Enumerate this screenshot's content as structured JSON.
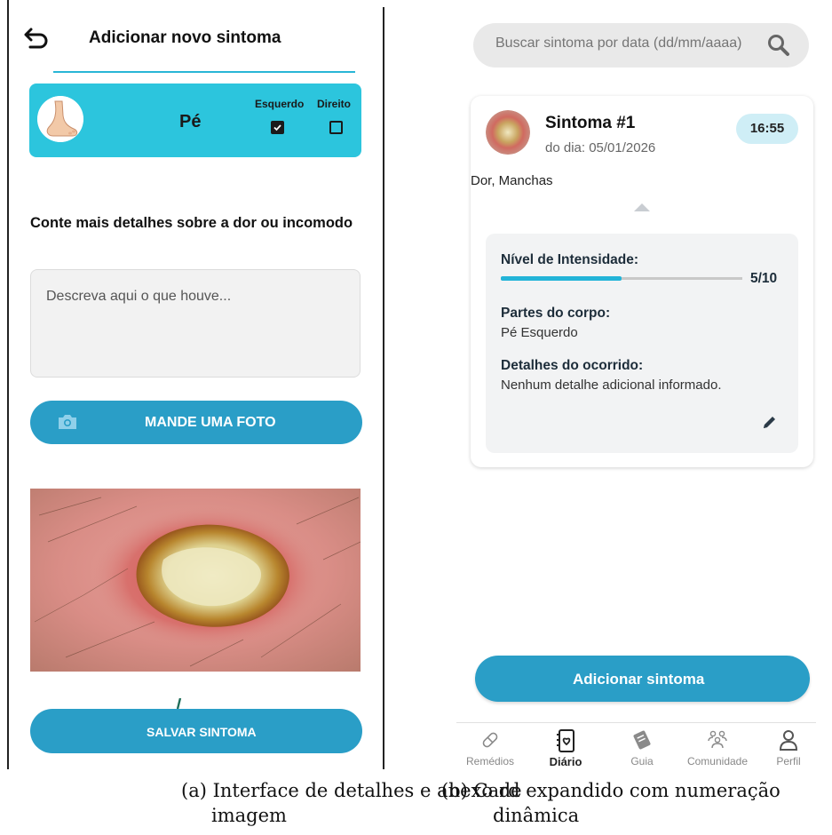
{
  "left": {
    "title": "Adicionar novo sintoma",
    "body_part": {
      "icon": "foot-icon",
      "label": "Pé",
      "left_label": "Esquerdo",
      "right_label": "Direito",
      "left_checked": true,
      "right_checked": false
    },
    "details_question": "Conte mais detalhes sobre  a dor ou incomodo",
    "description_placeholder": "Descreva aqui o que houve...",
    "photo_button": "MANDE UMA FOTO",
    "save_button": "SALVAR SINTOMA",
    "caption_line1": "(a) Interface de detalhes e anexo de",
    "caption_line2": "imagem"
  },
  "right": {
    "search_placeholder": "Buscar sintoma por data (dd/mm/aaaa)",
    "card": {
      "title": "Sintoma #1",
      "date": "do dia: 05/01/2026",
      "time": "16:55",
      "symptoms": "Dor, Manchas",
      "intensity_label": "Nível de Intensidade:",
      "intensity_value": "5/10",
      "intensity_fraction": 0.5,
      "body_parts_label": "Partes do corpo:",
      "body_parts_value": "Pé Esquerdo",
      "details_label": "Detalhes do ocorrido:",
      "details_value": "Nenhum detalhe adicional informado."
    },
    "add_button": "Adicionar sintoma",
    "nav": [
      {
        "label": "Remédios",
        "icon": "pill-icon",
        "active": false
      },
      {
        "label": "Diário",
        "icon": "journal-icon",
        "active": true
      },
      {
        "label": "Guia",
        "icon": "book-icon",
        "active": false
      },
      {
        "label": "Comunidade",
        "icon": "community-icon",
        "active": false
      },
      {
        "label": "Perfil",
        "icon": "profile-icon",
        "active": false
      }
    ],
    "caption_line1": "(b) Card expandido com numeração",
    "caption_line2": "dinâmica"
  },
  "colors": {
    "accent": "#2a9ec7",
    "card_teal": "#2cc5dd",
    "badge": "#cfeef6",
    "progress": "#23b4d8"
  }
}
